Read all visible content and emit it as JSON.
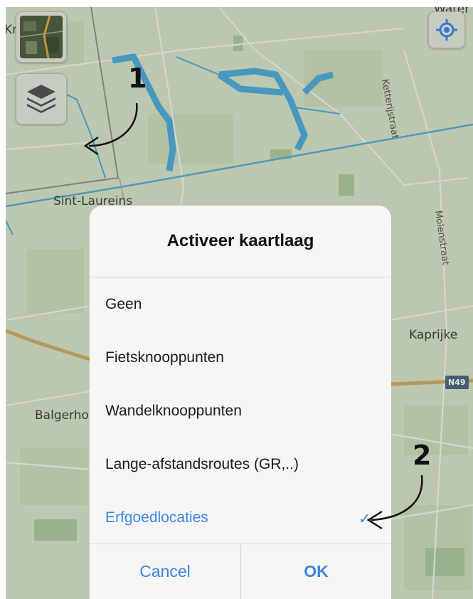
{
  "map": {
    "places": {
      "top_right": "Water",
      "top_left": "Kru",
      "sint_laureins": "Sint-Laureins",
      "kaprijke": "Kaprijke",
      "balgerhoeke": "Balgerho"
    },
    "streets": {
      "ketterijstraat": "Ketterijstraat",
      "molenstraat": "Molenstraat"
    },
    "road_shield": "N49",
    "buttons": {
      "satellite_toggle_icon": "satellite-thumbnail",
      "layers_icon": "layers-stack",
      "locate_icon": "location-target"
    },
    "colors": {
      "land": "#d2ddc4",
      "water": "#4da7d4",
      "accent": "#3a86e0"
    }
  },
  "annotations": {
    "one": "1",
    "two": "2"
  },
  "dialog": {
    "title": "Activeer kaartlaag",
    "options": [
      {
        "label": "Geen",
        "selected": false
      },
      {
        "label": "Fietsknooppunten",
        "selected": false
      },
      {
        "label": "Wandelknooppunten",
        "selected": false
      },
      {
        "label": "Lange-afstandsroutes (GR,..)",
        "selected": false
      },
      {
        "label": "Erfgoedlocaties",
        "selected": true
      }
    ],
    "check_mark": "✓",
    "cancel_label": "Cancel",
    "ok_label": "OK"
  }
}
